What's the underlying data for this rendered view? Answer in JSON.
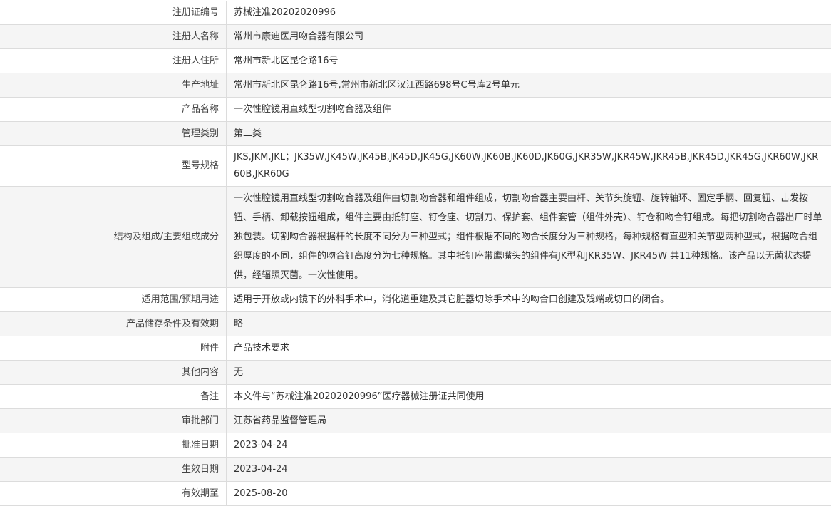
{
  "rows": [
    {
      "label": "注册证编号",
      "value": "苏械注准20202020996"
    },
    {
      "label": "注册人名称",
      "value": "常州市康迪医用吻合器有限公司"
    },
    {
      "label": "注册人住所",
      "value": "常州市新北区昆仑路16号"
    },
    {
      "label": "生产地址",
      "value": "常州市新北区昆仑路16号,常州市新北区汉江西路698号C号库2号单元"
    },
    {
      "label": "产品名称",
      "value": "一次性腔镜用直线型切割吻合器及组件"
    },
    {
      "label": "管理类别",
      "value": "第二类"
    },
    {
      "label": "型号规格",
      "value": "JKS,JKM,JKL；JK35W,JK45W,JK45B,JK45D,JK45G,JK60W,JK60B,JK60D,JK60G,JKR35W,JKR45W,JKR45B,JKR45D,JKR45G,JKR60W,JKR60B,JKR60G"
    },
    {
      "label": "结构及组成/主要组成成分",
      "value": "一次性腔镜用直线型切割吻合器及组件由切割吻合器和组件组成，切割吻合器主要由杆、关节头旋钮、旋转轴环、固定手柄、回复钮、击发按钮、手柄、卸载按钮组成，组件主要由抵钉座、钉仓座、切割刀、保护套、组件套管（组件外壳）、钉仓和吻合钉组成。每把切割吻合器出厂时单独包装。切割吻合器根据杆的长度不同分为三种型式；组件根据不同的吻合长度分为三种规格，每种规格有直型和关节型两种型式，根据吻合组织厚度的不同，组件的吻合钉高度分为七种规格。其中抵钉座带鹰嘴头的组件有JK型和JKR35W、JKR45W 共11种规格。该产品以无菌状态提供，经辐照灭菌。一次性使用。"
    },
    {
      "label": "适用范围/预期用途",
      "value": "适用于开放或内镜下的外科手术中，消化道重建及其它脏器切除手术中的吻合口创建及残端或切口的闭合。"
    },
    {
      "label": "产品储存条件及有效期",
      "value": "略"
    },
    {
      "label": "附件",
      "value": "产品技术要求"
    },
    {
      "label": "其他内容",
      "value": "无"
    },
    {
      "label": "备注",
      "value": "本文件与“苏械注准20202020996”医疗器械注册证共同使用"
    },
    {
      "label": "审批部门",
      "value": "江苏省药品监督管理局"
    },
    {
      "label": "批准日期",
      "value": "2023-04-24"
    },
    {
      "label": "生效日期",
      "value": "2023-04-24"
    },
    {
      "label": "有效期至",
      "value": "2025-08-20"
    }
  ]
}
